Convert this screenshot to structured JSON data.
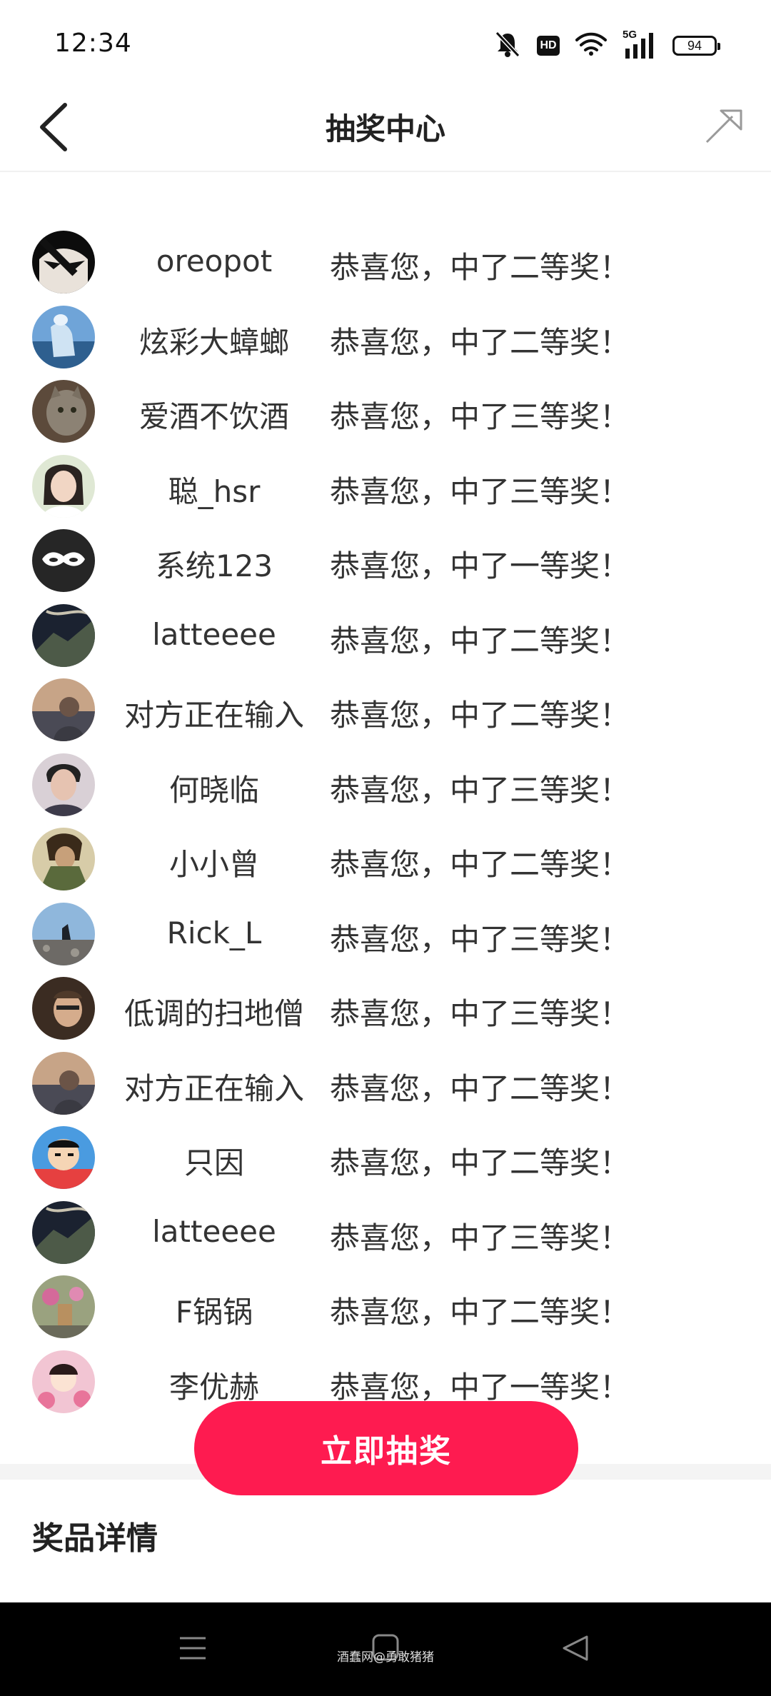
{
  "status_bar": {
    "time": "12:34",
    "hd_label": "HD",
    "network_label": "5G",
    "battery_level": "94"
  },
  "header": {
    "title": "抽奖中心"
  },
  "winners": [
    {
      "name": "oreopot",
      "message": "恭喜您，中了二等奖！"
    },
    {
      "name": "炫彩大蟑螂",
      "message": "恭喜您，中了二等奖！"
    },
    {
      "name": "爱酒不饮酒",
      "message": "恭喜您，中了三等奖！"
    },
    {
      "name": "聪_hsr",
      "message": "恭喜您，中了三等奖！"
    },
    {
      "name": "系统123",
      "message": "恭喜您，中了一等奖！"
    },
    {
      "name": "latteeee",
      "message": "恭喜您，中了二等奖！"
    },
    {
      "name": "对方正在输入",
      "message": "恭喜您，中了二等奖！"
    },
    {
      "name": "何晓临",
      "message": "恭喜您，中了三等奖！"
    },
    {
      "name": "小小曾",
      "message": "恭喜您，中了二等奖！"
    },
    {
      "name": "Rick_L",
      "message": "恭喜您，中了三等奖！"
    },
    {
      "name": "低调的扫地僧",
      "message": "恭喜您，中了三等奖！"
    },
    {
      "name": "对方正在输入",
      "message": "恭喜您，中了二等奖！"
    },
    {
      "name": "只因",
      "message": "恭喜您，中了二等奖！"
    },
    {
      "name": "latteeee",
      "message": "恭喜您，中了三等奖！"
    },
    {
      "name": "F锅锅",
      "message": "恭喜您，中了二等奖！"
    },
    {
      "name": "李优赫",
      "message": "恭喜您，中了一等奖！"
    }
  ],
  "draw_button_label": "立即抽奖",
  "prize_section_title": "奖品详情",
  "watermark": "酒蠢网@勇敢猪猪",
  "colors": {
    "accent": "#fe1b50",
    "text_primary": "#333333",
    "nav_background": "#000000"
  }
}
